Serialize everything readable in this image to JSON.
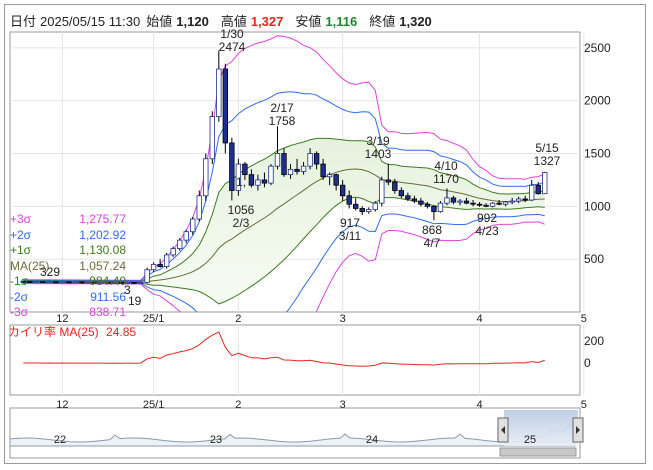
{
  "header": {
    "date_label": "日付",
    "date_value": "2025/05/15 11:30",
    "open_label": "始値",
    "open_value": "1,120",
    "high_label": "高値",
    "high_value": "1,327",
    "low_label": "安値",
    "low_value": "1,116",
    "close_label": "終値",
    "close_value": "1,320"
  },
  "bands": [
    {
      "label": "+3σ",
      "value": "1,275.77",
      "color": "#e040e0"
    },
    {
      "label": "+2σ",
      "value": "1,202.92",
      "color": "#2e6cf0"
    },
    {
      "label": "+1σ",
      "value": "1,130.08",
      "color": "#3d7a1f"
    },
    {
      "label": "MA(25)",
      "value": "1,057.24",
      "color": "#6a6a3a"
    },
    {
      "label": "-1σ",
      "value": "984.40",
      "color": "#3d7a1f"
    },
    {
      "label": "-2σ",
      "value": "911.56",
      "color": "#2e6cf0"
    },
    {
      "label": "-3σ",
      "value": "838.71",
      "color": "#e040e0"
    }
  ],
  "sub_panel": {
    "label": "カイリ率 MA(25)",
    "value": "24.85",
    "ticks": [
      "200",
      "0"
    ]
  },
  "chart_data": {
    "type": "candlestick",
    "y_ticks": [
      500,
      1000,
      1500,
      2000,
      2500
    ],
    "ylim": [
      0,
      2650
    ],
    "x_ticks": [
      "12",
      "25/1",
      "2",
      "3",
      "4",
      "5"
    ],
    "annotations": [
      {
        "date": "1/30",
        "value": "2474"
      },
      {
        "date": "2/17",
        "value": "1758"
      },
      {
        "date": "2/3",
        "value": "1056"
      },
      {
        "date": "3/19",
        "value": "1403"
      },
      {
        "date": "3/11",
        "value": "917"
      },
      {
        "date": "4/10",
        "value": "1170"
      },
      {
        "date": "4/7",
        "value": "868"
      },
      {
        "date": "4/23",
        "value": "992"
      },
      {
        "date": "5/15",
        "value": "1327"
      }
    ],
    "partial_labels": [
      "329",
      "19",
      "1,",
      "3"
    ],
    "candles": [
      [
        290,
        292,
        285,
        288
      ],
      [
        288,
        290,
        284,
        286
      ],
      [
        286,
        289,
        283,
        287
      ],
      [
        287,
        290,
        284,
        285
      ],
      [
        285,
        288,
        282,
        286
      ],
      [
        286,
        289,
        283,
        284
      ],
      [
        284,
        287,
        281,
        285
      ],
      [
        285,
        288,
        282,
        283
      ],
      [
        283,
        286,
        280,
        284
      ],
      [
        284,
        287,
        281,
        282
      ],
      [
        282,
        285,
        279,
        283
      ],
      [
        283,
        286,
        280,
        281
      ],
      [
        281,
        284,
        278,
        282
      ],
      [
        282,
        285,
        279,
        280
      ],
      [
        280,
        283,
        277,
        281
      ],
      [
        281,
        284,
        278,
        279
      ],
      [
        279,
        282,
        276,
        280
      ],
      [
        280,
        283,
        277,
        278
      ],
      [
        278,
        281,
        275,
        279
      ],
      [
        280,
        420,
        270,
        400
      ],
      [
        400,
        470,
        380,
        450
      ],
      [
        450,
        500,
        420,
        430
      ],
      [
        430,
        560,
        410,
        540
      ],
      [
        540,
        620,
        520,
        600
      ],
      [
        600,
        700,
        580,
        680
      ],
      [
        680,
        780,
        650,
        760
      ],
      [
        760,
        900,
        730,
        880
      ],
      [
        880,
        1150,
        860,
        1100
      ],
      [
        1100,
        1500,
        1050,
        1450
      ],
      [
        1450,
        1900,
        1400,
        1850
      ],
      [
        1850,
        2474,
        1800,
        2300
      ],
      [
        2300,
        2350,
        1500,
        1600
      ],
      [
        1600,
        1650,
        1056,
        1150
      ],
      [
        1150,
        1450,
        1100,
        1400
      ],
      [
        1400,
        1420,
        1250,
        1300
      ],
      [
        1300,
        1350,
        1180,
        1200
      ],
      [
        1200,
        1300,
        1150,
        1250
      ],
      [
        1250,
        1320,
        1180,
        1220
      ],
      [
        1220,
        1400,
        1200,
        1380
      ],
      [
        1380,
        1758,
        1350,
        1500
      ],
      [
        1500,
        1550,
        1280,
        1300
      ],
      [
        1300,
        1400,
        1260,
        1350
      ],
      [
        1350,
        1450,
        1300,
        1330
      ],
      [
        1330,
        1420,
        1300,
        1380
      ],
      [
        1380,
        1550,
        1350,
        1500
      ],
      [
        1500,
        1520,
        1350,
        1400
      ],
      [
        1400,
        1450,
        1250,
        1280
      ],
      [
        1280,
        1320,
        1200,
        1300
      ],
      [
        1300,
        1310,
        1150,
        1200
      ],
      [
        1200,
        1250,
        1050,
        1100
      ],
      [
        1100,
        1150,
        980,
        1020
      ],
      [
        1020,
        1080,
        960,
        980
      ],
      [
        980,
        1000,
        917,
        950
      ],
      [
        950,
        990,
        930,
        970
      ],
      [
        970,
        1050,
        950,
        1030
      ],
      [
        1030,
        1280,
        1000,
        1250
      ],
      [
        1250,
        1403,
        1200,
        1230
      ],
      [
        1230,
        1260,
        1120,
        1150
      ],
      [
        1150,
        1180,
        1080,
        1100
      ],
      [
        1100,
        1130,
        1050,
        1070
      ],
      [
        1070,
        1100,
        1030,
        1050
      ],
      [
        1050,
        1080,
        1000,
        1020
      ],
      [
        1020,
        1040,
        980,
        1000
      ],
      [
        1000,
        1010,
        868,
        950
      ],
      [
        950,
        1050,
        940,
        1030
      ],
      [
        1030,
        1170,
        1010,
        1080
      ],
      [
        1080,
        1100,
        1020,
        1040
      ],
      [
        1040,
        1070,
        1010,
        1050
      ],
      [
        1050,
        1080,
        1020,
        1030
      ],
      [
        1030,
        1060,
        1000,
        1020
      ],
      [
        1020,
        1040,
        995,
        1010
      ],
      [
        1010,
        1030,
        992,
        1000
      ],
      [
        1000,
        1040,
        990,
        1030
      ],
      [
        1030,
        1060,
        1010,
        1020
      ],
      [
        1020,
        1050,
        1000,
        1040
      ],
      [
        1040,
        1080,
        1020,
        1050
      ],
      [
        1050,
        1090,
        1030,
        1070
      ],
      [
        1070,
        1100,
        1040,
        1060
      ],
      [
        1060,
        1250,
        1050,
        1200
      ],
      [
        1200,
        1230,
        1110,
        1120
      ],
      [
        1120,
        1327,
        1116,
        1320
      ]
    ],
    "sub_labels": [
      "22",
      "23",
      "24",
      "25"
    ]
  }
}
